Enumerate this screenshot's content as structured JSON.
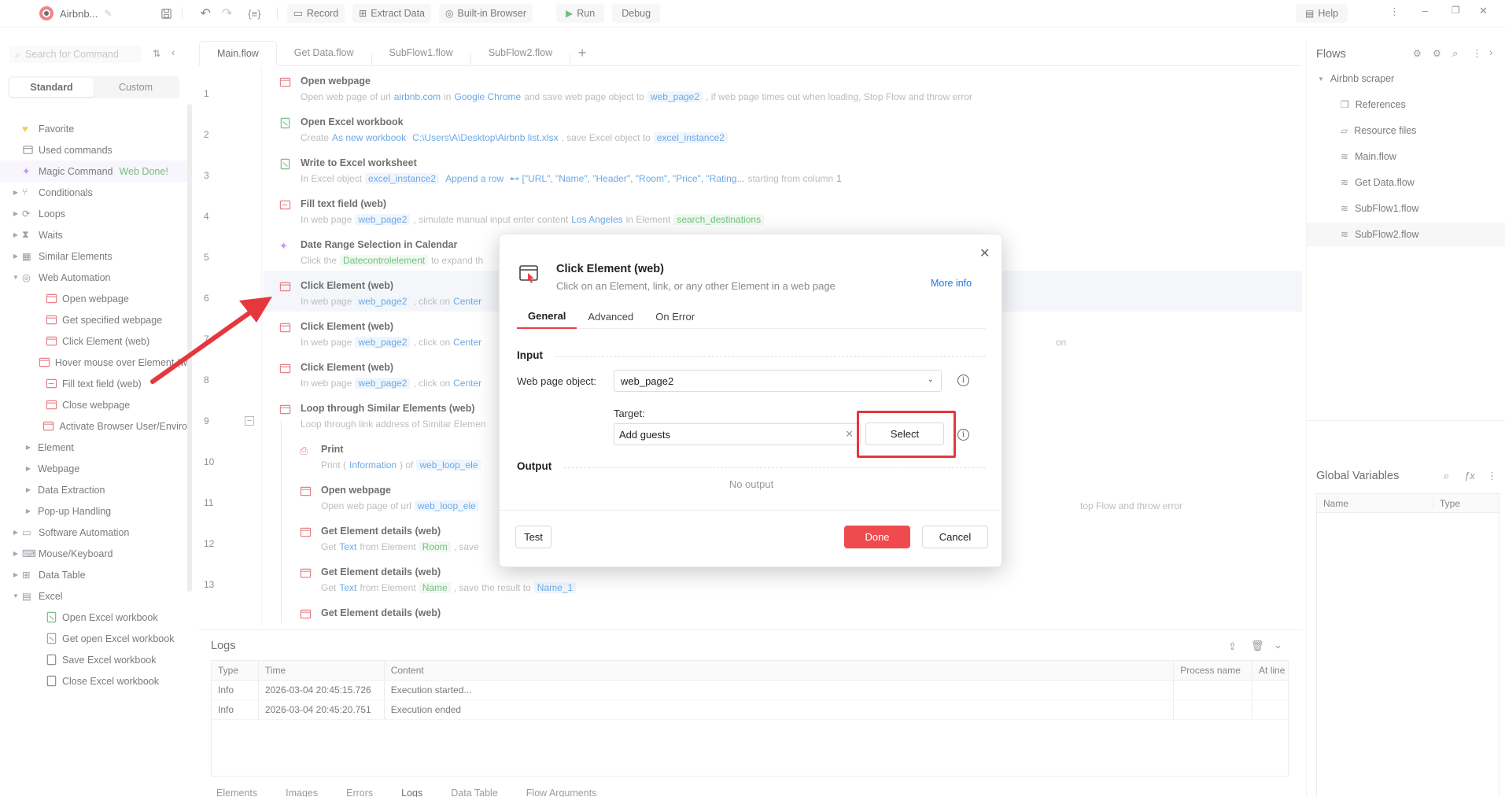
{
  "app": {
    "title": "Airbnb..."
  },
  "toolbar": {
    "record": "Record",
    "extract": "Extract Data",
    "browser": "Built-in Browser",
    "run": "Run",
    "debug": "Debug",
    "help": "Help"
  },
  "left": {
    "search_placeholder": "Search for Command",
    "tab_standard": "Standard",
    "tab_custom": "Custom",
    "items": [
      {
        "label": "Favorite"
      },
      {
        "label": "Used commands"
      },
      {
        "label": "Magic Command",
        "badge": "Web Done!"
      },
      {
        "label": "Conditionals"
      },
      {
        "label": "Loops"
      },
      {
        "label": "Waits"
      },
      {
        "label": "Similar Elements"
      },
      {
        "label": "Web Automation"
      },
      {
        "label": "Open webpage"
      },
      {
        "label": "Get specified webpage"
      },
      {
        "label": "Click Element (web)"
      },
      {
        "label": "Hover mouse over Element (w"
      },
      {
        "label": "Fill text field (web)"
      },
      {
        "label": "Close webpage"
      },
      {
        "label": "Activate Browser User/Enviro"
      },
      {
        "label": "Element"
      },
      {
        "label": "Webpage"
      },
      {
        "label": "Data Extraction"
      },
      {
        "label": "Pop-up Handling"
      },
      {
        "label": "Software Automation"
      },
      {
        "label": "Mouse/Keyboard"
      },
      {
        "label": "Data Table"
      },
      {
        "label": "Excel"
      },
      {
        "label": "Open Excel workbook"
      },
      {
        "label": "Get open Excel workbook"
      },
      {
        "label": "Save Excel workbook"
      },
      {
        "label": "Close Excel workbook"
      }
    ]
  },
  "tabs": [
    "Main.flow",
    "Get Data.flow",
    "SubFlow1.flow",
    "SubFlow2.flow"
  ],
  "lines": [
    "1",
    "2",
    "3",
    "4",
    "5",
    "6",
    "7",
    "8",
    "9",
    "10",
    "11",
    "12",
    "13"
  ],
  "steps": {
    "s1": {
      "title": "Open webpage",
      "a": "Open web page of url",
      "b": "airbnb.com",
      "c": "in",
      "d": "Google Chrome",
      "e": "and save web page object to",
      "f": "web_page2",
      "g": ", if web page times out when loading, Stop Flow and throw error"
    },
    "s2": {
      "title": "Open Excel workbook",
      "a": "Create",
      "b": "As new workbook",
      "c": "C:\\Users\\A\\Desktop\\Airbnb list.xlsx",
      "d": ", save Excel object to",
      "e": "excel_instance2"
    },
    "s3": {
      "title": "Write to Excel worksheet",
      "a": "In Excel object",
      "b": "excel_instance2",
      "c": "Append a row",
      "d": "⊷ [\"URL\", \"Name\", \"Header\", \"Room\", \"Price\", \"Rating...",
      "e": "starting from column",
      "f": "1"
    },
    "s4": {
      "title": "Fill text field (web)",
      "a": "In web page",
      "b": "web_page2",
      "c": ", simulate manual input enter content",
      "d": "Los Angeles",
      "e": "in Element",
      "f": "search_destinations"
    },
    "s5": {
      "title": "Date Range Selection in Calendar",
      "a": "Click the",
      "b": "Datecontrolelement",
      "c": "to expand th"
    },
    "s6": {
      "title": "Click Element (web)",
      "a": "In web page",
      "b": "web_page2",
      "c": ", click on",
      "d": "Center"
    },
    "s7": {
      "title": "Click Element (web)",
      "a": "In web page",
      "b": "web_page2",
      "c": ", click on",
      "d": "Center",
      "tail": "on"
    },
    "s8": {
      "title": "Click Element (web)",
      "a": "In web page",
      "b": "web_page2",
      "c": ", click on",
      "d": "Center"
    },
    "s9": {
      "title": "Loop through Similar Elements (web)",
      "a": "Loop through link address of Similar Elemen"
    },
    "s10": {
      "title": "Print",
      "a": "Print (",
      "b": "Information",
      "c": ") of",
      "d": "web_loop_ele"
    },
    "s11": {
      "title": "Open webpage",
      "a": "Open web page of url",
      "b": "web_loop_ele",
      "tail": "top Flow and throw error"
    },
    "s12": {
      "title": "Get Element details (web)",
      "a": "Get",
      "b": "Text",
      "c": "from Element",
      "d": "Room",
      "e": ", save"
    },
    "s13": {
      "title": "Get Element details (web)",
      "a": "Get",
      "b": "Text",
      "c": "from Element",
      "d": "Name",
      "e": ", save the result to",
      "f": "Name_1"
    },
    "s14": {
      "title": "Get Element details (web)"
    }
  },
  "logs": {
    "title": "Logs",
    "columns": [
      "Type",
      "Time",
      "Content",
      "Process name",
      "At line"
    ],
    "rows": [
      {
        "type": "Info",
        "time": "2026-03-04 20:45:15.726",
        "content": "Execution started..."
      },
      {
        "type": "Info",
        "time": "2026-03-04 20:45:20.751",
        "content": "Execution ended"
      }
    ],
    "bottom_tabs": [
      "Elements",
      "Images",
      "Errors",
      "Logs",
      "Data Table",
      "Flow Arguments"
    ]
  },
  "right": {
    "title": "Flows",
    "root": "Airbnb scraper",
    "items": [
      "References",
      "Resource files",
      "Main.flow",
      "Get Data.flow",
      "SubFlow1.flow",
      "SubFlow2.flow"
    ],
    "gv_title": "Global Variables",
    "gv_cols": [
      "Name",
      "Type"
    ]
  },
  "dialog": {
    "title": "Click Element (web)",
    "subtitle": "Click on an Element, link, or any other Element in a web page",
    "more_info": "More info",
    "tabs": [
      "General",
      "Advanced",
      "On Error"
    ],
    "input_section": "Input",
    "webpage_label": "Web page object:",
    "webpage_value": "web_page2",
    "target_label": "Target:",
    "target_value": "Add guests",
    "select_btn": "Select",
    "output_section": "Output",
    "no_output": "No output",
    "test_btn": "Test",
    "done_btn": "Done",
    "cancel_btn": "Cancel"
  },
  "colors": {
    "accent": "#ef4b4f",
    "link": "#1d79d8",
    "green": "#2a9a3a",
    "highlight": "#e5373e"
  }
}
